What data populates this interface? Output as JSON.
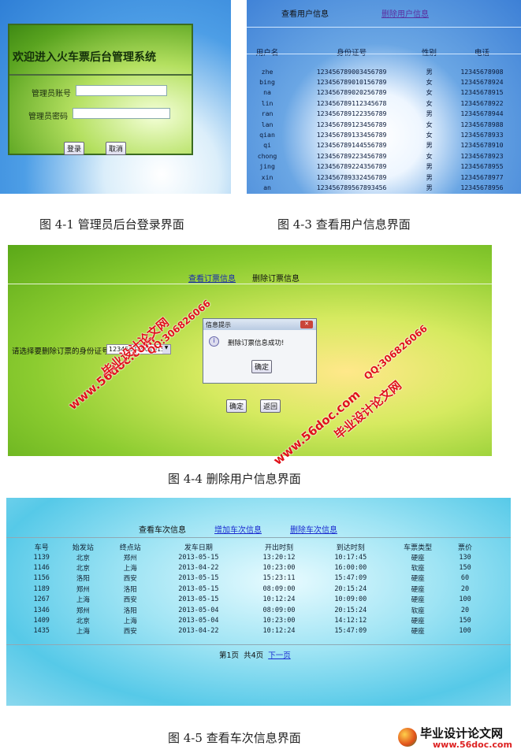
{
  "fig1": {
    "title": "欢迎进入火车票后台管理系统",
    "account_label": "管理员账号",
    "password_label": "管理员密码",
    "account_value": "",
    "password_value": "",
    "login": "登录",
    "cancel": "取消",
    "caption": "图 4-1  管理员后台登录界面"
  },
  "fig3": {
    "nav": {
      "view": "查看用户信息",
      "delete": "删除用户信息"
    },
    "headers": [
      "用户名",
      "身份证号",
      "性别",
      "电话"
    ],
    "rows": [
      [
        "zhe",
        "123456789003456789",
        "男",
        "12345678908"
      ],
      [
        "bing",
        "123456789010156789",
        "女",
        "12345678924"
      ],
      [
        "na",
        "123456789020256789",
        "女",
        "12345678915"
      ],
      [
        "lin",
        "123456789112345678",
        "女",
        "12345678922"
      ],
      [
        "ran",
        "123456789122356789",
        "男",
        "12345678944"
      ],
      [
        "lan",
        "123456789123456789",
        "女",
        "12345678988"
      ],
      [
        "qian",
        "123456789133456789",
        "女",
        "12345678933"
      ],
      [
        "qi",
        "123456789144556789",
        "男",
        "12345678910"
      ],
      [
        "chong",
        "123456789223456789",
        "女",
        "12345678923"
      ],
      [
        "jing",
        "123456789224356789",
        "男",
        "12345678955"
      ],
      [
        "xin",
        "123456789332456789",
        "男",
        "12345678977"
      ],
      [
        "an",
        "123456789567893456",
        "男",
        "12345678956"
      ]
    ],
    "caption": "图 4-3  查看用户信息界面"
  },
  "fig4": {
    "nav": {
      "view": "查看订票信息",
      "delete": "删除订票信息"
    },
    "select_label": "请选择要删除订票的身份证号",
    "select_value": "123456789010156789",
    "dialog": {
      "title": "信息提示",
      "message": "删除订票信息成功!",
      "ok": "确定"
    },
    "confirm": "确定",
    "back": "返回",
    "caption": "图 4-4  删除用户信息界面"
  },
  "watermark": {
    "site": "www.56doc.com",
    "name": "毕业设计论文网",
    "qq": "QQ:306826066"
  },
  "fig5": {
    "nav": {
      "view": "查看车次信息",
      "add": "增加车次信息",
      "delete": "删除车次信息"
    },
    "headers": [
      "车号",
      "始发站",
      "终点站",
      "发车日期",
      "开出时刻",
      "到达时刻",
      "车票类型",
      "票价"
    ],
    "rows": [
      [
        "1139",
        "北京",
        "郑州",
        "2013-05-15",
        "13:20:12",
        "10:17:45",
        "硬座",
        "130"
      ],
      [
        "1146",
        "北京",
        "上海",
        "2013-04-22",
        "10:23:00",
        "16:00:00",
        "软座",
        "150"
      ],
      [
        "1156",
        "洛阳",
        "西安",
        "2013-05-15",
        "15:23:11",
        "15:47:09",
        "硬座",
        "60"
      ],
      [
        "1189",
        "郑州",
        "洛阳",
        "2013-05-15",
        "08:09:00",
        "20:15:24",
        "硬座",
        "20"
      ],
      [
        "1267",
        "上海",
        "西安",
        "2013-05-15",
        "10:12:24",
        "10:09:00",
        "硬座",
        "100"
      ],
      [
        "1346",
        "郑州",
        "洛阳",
        "2013-05-04",
        "08:09:00",
        "20:15:24",
        "软座",
        "20"
      ],
      [
        "1409",
        "北京",
        "上海",
        "2013-05-04",
        "10:23:00",
        "14:12:12",
        "硬座",
        "150"
      ],
      [
        "1435",
        "上海",
        "西安",
        "2013-04-22",
        "10:12:24",
        "15:47:09",
        "硬座",
        "100"
      ]
    ],
    "pager": {
      "current": "第1页",
      "total": "共4页",
      "next": "下一页"
    },
    "caption": "图 4-5  查看车次信息界面"
  },
  "logo": {
    "name": "毕业设计论文网",
    "url": "www.56doc.com"
  }
}
